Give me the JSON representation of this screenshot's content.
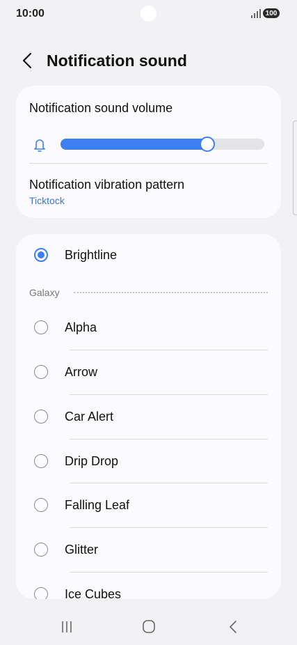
{
  "status": {
    "time": "10:00",
    "battery": "100"
  },
  "header": {
    "title": "Notification sound"
  },
  "volume": {
    "label": "Notification sound volume",
    "level_percent": 72
  },
  "vibration": {
    "label": "Notification vibration pattern",
    "value": "Ticktock"
  },
  "selected_sound": {
    "label": "Brightline",
    "checked": true
  },
  "galaxy_group": {
    "label": "Galaxy",
    "items": [
      {
        "label": "Alpha"
      },
      {
        "label": "Arrow"
      },
      {
        "label": "Car Alert"
      },
      {
        "label": "Drip Drop"
      },
      {
        "label": "Falling Leaf"
      },
      {
        "label": "Glitter"
      },
      {
        "label": "Ice Cubes"
      }
    ]
  },
  "colors": {
    "accent": "#3d7ef0",
    "link": "#3b74d6",
    "background": "#f2f2f4",
    "card": "#fbfbfd"
  }
}
